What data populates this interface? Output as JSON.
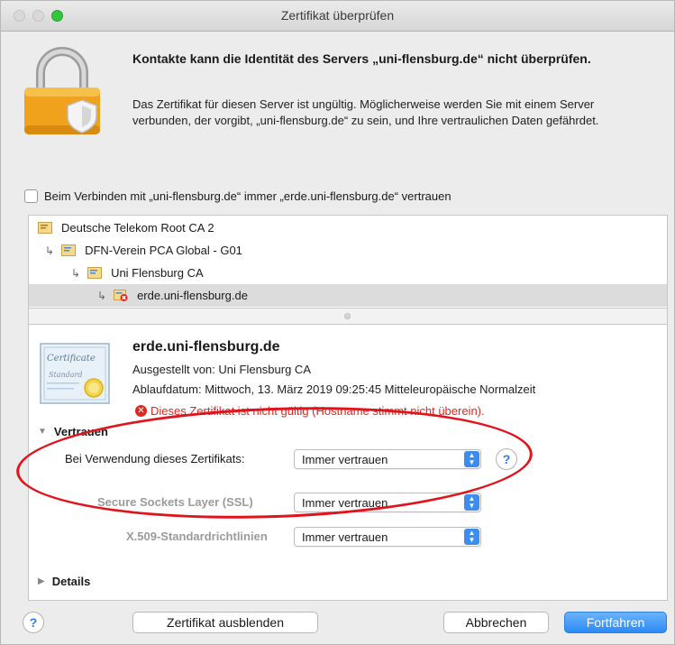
{
  "window": {
    "title": "Zertifikat überprüfen"
  },
  "header": {
    "headline": "Kontakte kann die Identität des Servers „uni-flensburg.de“ nicht überprüfen.",
    "description": "Das Zertifikat für diesen Server ist ungültig. Möglicherweise werden Sie mit einem Server verbunden, der vorgibt, „uni-flensburg.de“ zu sein, und Ihre vertraulichen Daten gefährdet."
  },
  "trust_checkbox": {
    "label": "Beim Verbinden mit „uni-flensburg.de“ immer „erde.uni-flensburg.de“ vertrauen",
    "checked": false
  },
  "chain": [
    {
      "label": "Deutsche Telekom Root CA 2",
      "icon": "certificate-icon",
      "selected": false
    },
    {
      "label": "DFN-Verein PCA Global - G01",
      "icon": "certificate-icon",
      "selected": false
    },
    {
      "label": "Uni Flensburg CA",
      "icon": "certificate-icon",
      "selected": false
    },
    {
      "label": "erde.uni-flensburg.de",
      "icon": "certificate-error-icon",
      "selected": true
    }
  ],
  "certificate": {
    "name": "erde.uni-flensburg.de",
    "issuer": "Ausgestellt von: Uni Flensburg CA",
    "expires": "Ablaufdatum: Mittwoch, 13. März 2019 09:25:45 Mitteleuropäische Normalzeit",
    "error": "Dieses Zertifikat ist nicht gültig (Hostname stimmt nicht überein).",
    "badge_lines": [
      "Certificate",
      "Standard"
    ]
  },
  "trust": {
    "section_label": "Vertrauen",
    "when_using_label": "Bei Verwendung dieses Zertifikats:",
    "when_using_value": "Immer vertrauen",
    "ssl_label": "Secure Sockets Layer (SSL)",
    "ssl_value": "Immer vertrauen",
    "x509_label": "X.509-Standardrichtlinien",
    "x509_value": "Immer vertrauen"
  },
  "details": {
    "section_label": "Details"
  },
  "buttons": {
    "help": "?",
    "hide_certificate": "Zertifikat ausblenden",
    "cancel": "Abbrechen",
    "continue": "Fortfahren"
  },
  "colors": {
    "accent": "#2b8af6",
    "error": "#e0271f",
    "annotation": "#e0141c"
  }
}
